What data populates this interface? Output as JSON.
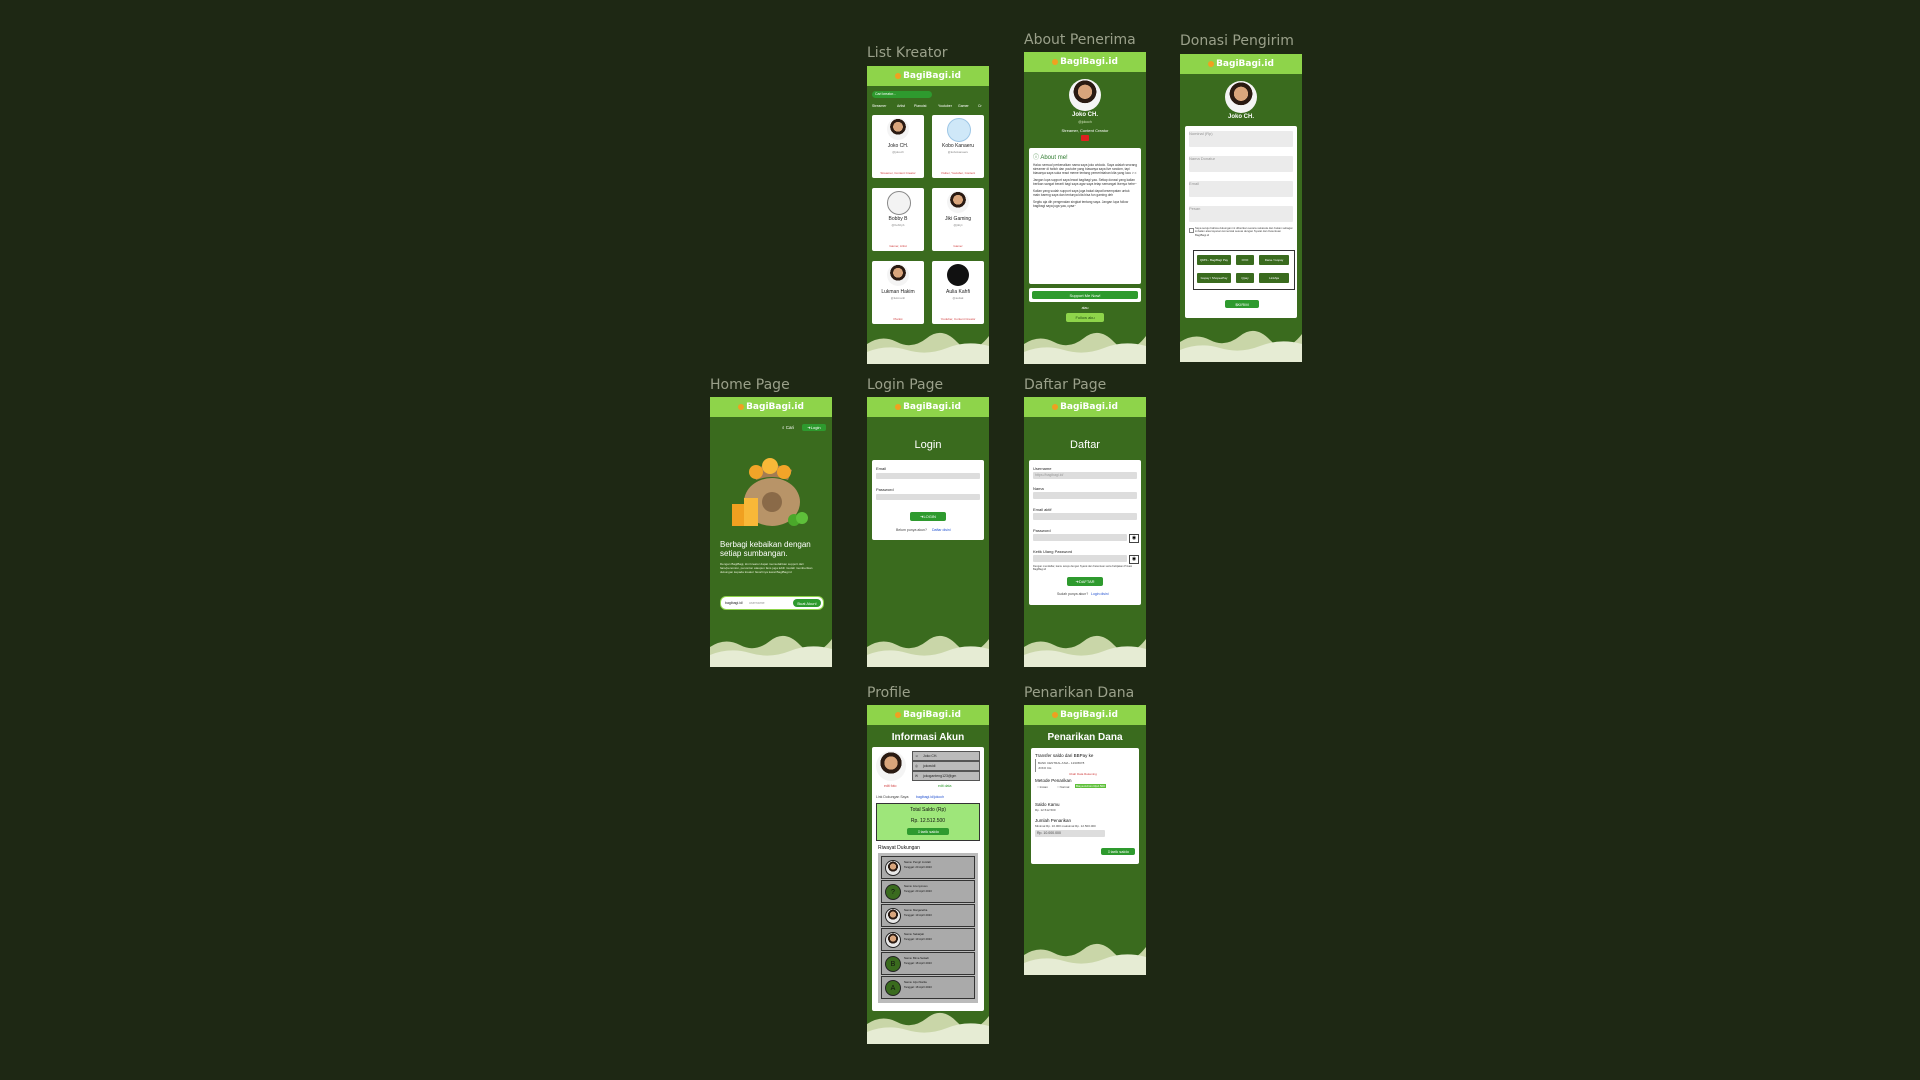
{
  "frames": {
    "list_kreator": "List Kreator",
    "about_penerima": "About Penerima",
    "donasi_pengirim": "Donasi Pengirim",
    "home_page": "Home Page",
    "login_page": "Login Page",
    "daftar_page": "Daftar Page",
    "profile": "Profile",
    "penarikan_dana": "Penarikan Dana"
  },
  "brand": "BagiBagi.id",
  "colors": {
    "bg": "#1e2814",
    "frame": "#3a6b1e",
    "header": "#8ed44a",
    "button": "#2e9a2e"
  },
  "list": {
    "search_placeholder": "Cari kreator...",
    "tabs": [
      "Streamer",
      "Artist",
      "Pianoist",
      "Youtuber",
      "Gamer",
      "Cr"
    ],
    "creators": [
      {
        "name": "Joko CH.",
        "handle": "@jokoch",
        "role": "Streamer, Content Creator"
      },
      {
        "name": "Kobo Kanaeru",
        "handle": "@kobokanaeru",
        "role": "Vtuber, Youtuber, Content"
      },
      {
        "name": "Bobby B",
        "handle": "@bobbyb",
        "role": "Gamer, Artist"
      },
      {
        "name": "Jiki Gaming",
        "handle": "@jikiyt",
        "role": "Gamer"
      },
      {
        "name": "Lukman Hakim",
        "handle": "@lukmanh",
        "role": "Pianist"
      },
      {
        "name": "Aulia Kahfi",
        "handle": "@auliak",
        "role": "Youtuber, Content Creator"
      }
    ]
  },
  "about": {
    "name": "Joko CH.",
    "handle": "@jokoch",
    "role": "Streamer, Content Creator",
    "title": "About me!",
    "p1": "Haloo semua! perkenalkan nama saya joko widodo. Saya adalah seorang streamer di twitch dan youtube yang biasanya saya live random, tapi biasanya saya suka react meme tentang pemerintahan kita yang lucu >.<",
    "p2": "Jangan lupa support saya lewat bagibagi yaa. Setiap donasi yang kalian berikan sangat berarti bagi saya agar saya tetap semangat livenya hehe~",
    "p3": "Kalian yang sudah support saya juga bakal dapat kesempatan untuk main bareng saya dan tentunya kita bisa fun gaming deh",
    "p4": "Segitu aja dih pengenalan singkat tentang saya. Jangan lupa follow bagibagi saya juga yaa, cyaa~",
    "support_btn": "Support Me Now!",
    "or": "atau",
    "follow_btn": "Follow aku"
  },
  "donasi": {
    "name": "Joko CH.",
    "fields": [
      "Nominal (Rp)",
      "Nama Donatur",
      "Email",
      "Pesan"
    ],
    "agree": "Saya setuju bahwa dukungan ini diberikan secara sukarela dan bukan sebagai imbalan atas layanan komersial sesuai dengan Syarat dan Ketentuan BagiBagi.id",
    "methods": [
      "QRIS - BagiBagi Pay",
      "OVO",
      "Dana / Gopay",
      "Gopay / ShopeePay",
      "Qpay",
      "LinkAja"
    ],
    "submit": "KIRIM"
  },
  "home": {
    "search": "Cari",
    "login": "Login",
    "headline": "Berbagi kebaikan dengan setiap sumbangan.",
    "sub": "Dengan BagiBagi, kini kreator dapat memudahkan support dari fans/penonton, penonton ataupun fans juga lebih mudah memberikan dukungan kepada kreator favoritnya lewat BagiBagi.id",
    "prefix": "bagibagi.id/",
    "placeholder": "username",
    "cta": "Buat Akun!"
  },
  "login": {
    "title": "Login",
    "email": "Email",
    "password": "Password",
    "btn": "LOGIN",
    "no_account": "Belum punya akun?",
    "register": "Daftar disini"
  },
  "daftar": {
    "title": "Daftar",
    "username": "Username",
    "username_ph": "https://bagibagi.id/",
    "nama": "Nama",
    "email": "Email aktif",
    "password": "Password",
    "repeat": "Ketik Ulang Password",
    "terms": "Dengan mendaftar, kamu setuju dengan Syarat dan Ketentuan serta Kebijakan Privasi BagiBagi.id",
    "btn": "DAFTAR",
    "have_account": "Sudah punya akun?",
    "login_link": "Login disini"
  },
  "profile": {
    "title": "Informasi Akun",
    "name": "Joko CH.",
    "username": "jokowidi",
    "email": "jokoganteng123@gm",
    "edit": "edit foto",
    "edit2": "edit data",
    "link_label": "Link Dukungan Saya:",
    "link": "bagibagi.id/jokoch",
    "saldo_label": "Total Saldo (Rp)",
    "saldo": "Rp. 12.512.500",
    "tarik": "tarik saldo",
    "history_title": "Riwayat Dukungan",
    "history": [
      {
        "initial": "",
        "name": "Nama: Pengri Jumlah",
        "date": "Tanggal: 20 April 2023"
      },
      {
        "initial": "?",
        "name": "Nama: Anonymous",
        "date": "Tanggal: 20 April 2023"
      },
      {
        "initial": "",
        "name": "Nama: Margaretha",
        "date": "Tanggal: 19 April 2023"
      },
      {
        "initial": "",
        "name": "Nama: Sekarjati",
        "date": "Tanggal: 19 April 2023"
      },
      {
        "initial": "B",
        "name": "Nama: Bima Setiadi",
        "date": "Tanggal: 18 April 2023"
      },
      {
        "initial": "A",
        "name": "Nama: Arjui Narita",
        "date": "Tanggal: 18 April 2023"
      }
    ]
  },
  "penarikan": {
    "title": "Penarikan Dana",
    "transfer": "Transfer saldo dari BBPay ke",
    "bank": "BANK CENTRAL ASIA - 12345678",
    "holder": "JOKO CH.",
    "ubah": "Ubah Data Rekening",
    "metode": "Metode Penarikan",
    "opt1": "Instan",
    "opt2": "Normal",
    "badge": "Biaya Admin Rp2.500",
    "saldo_label": "Saldo Kamu",
    "saldo": "Rp. 12.512.500",
    "jumlah_label": "Jumlah Penarikan",
    "jumlah_hint": "Minimal Rp. 10.000 maksimal Rp. 12.500.000",
    "jumlah": "Rp. 10.000.000",
    "btn": "tarik saldo"
  }
}
